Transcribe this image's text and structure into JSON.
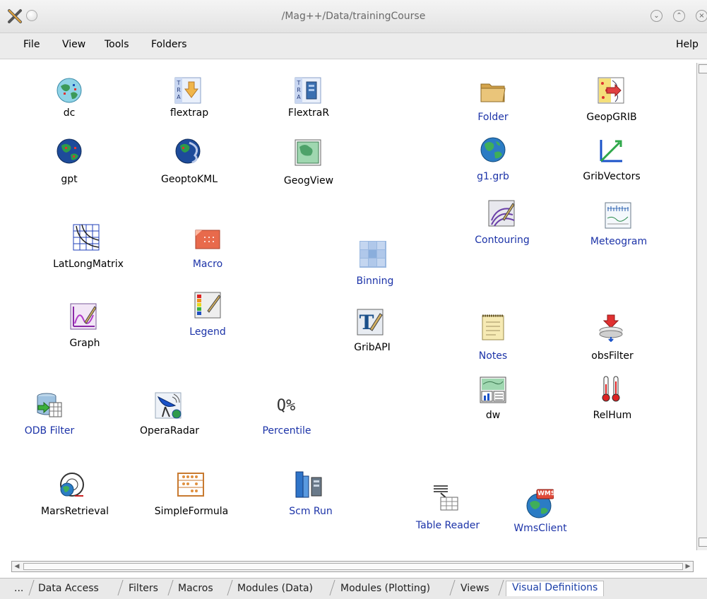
{
  "window": {
    "title": "/Mag++/Data/trainingCourse"
  },
  "menu": {
    "file": "File",
    "view": "View",
    "tools": "Tools",
    "folders": "Folders",
    "help": "Help"
  },
  "items": {
    "dc": "dc",
    "flextrap": "flextrap",
    "flextrar": "FlextraR",
    "folder": "Folder",
    "geopgrib": "GeopGRIB",
    "gpt": "gpt",
    "geoptokml": "GeoptoKML",
    "geogview": "GeogView",
    "g1grb": "g1.grb",
    "gribvectors": "GribVectors",
    "contouring": "Contouring",
    "meteogram": "Meteogram",
    "latlongmatrix": "LatLongMatrix",
    "macro": "Macro",
    "binning": "Binning",
    "graph": "Graph",
    "legend": "Legend",
    "gribapi": "GribAPI",
    "notes": "Notes",
    "obsfilter": "obsFilter",
    "dw": "dw",
    "relhum": "RelHum",
    "odbfilter": "ODB Filter",
    "operaradar": "OperaRadar",
    "percentile": "Percentile",
    "marsretrieval": "MarsRetrieval",
    "simpleformula": "SimpleFormula",
    "scmrun": "Scm Run",
    "tablereader": "Table Reader",
    "wmsclient": "WmsClient",
    "percentile_icon_text": "Q%",
    "wms_icon_text": "WMS",
    "flextra_icon_text": "TRA"
  },
  "tabs": {
    "more": "...",
    "data_access": "Data Access",
    "filters": "Filters",
    "macros": "Macros",
    "modules_data": "Modules (Data)",
    "modules_plotting": "Modules (Plotting)",
    "views": "Views",
    "visual_definitions": "Visual Definitions"
  },
  "colors": {
    "folder_label": "#1c33a8",
    "active_tab": "#1b3fa8"
  }
}
